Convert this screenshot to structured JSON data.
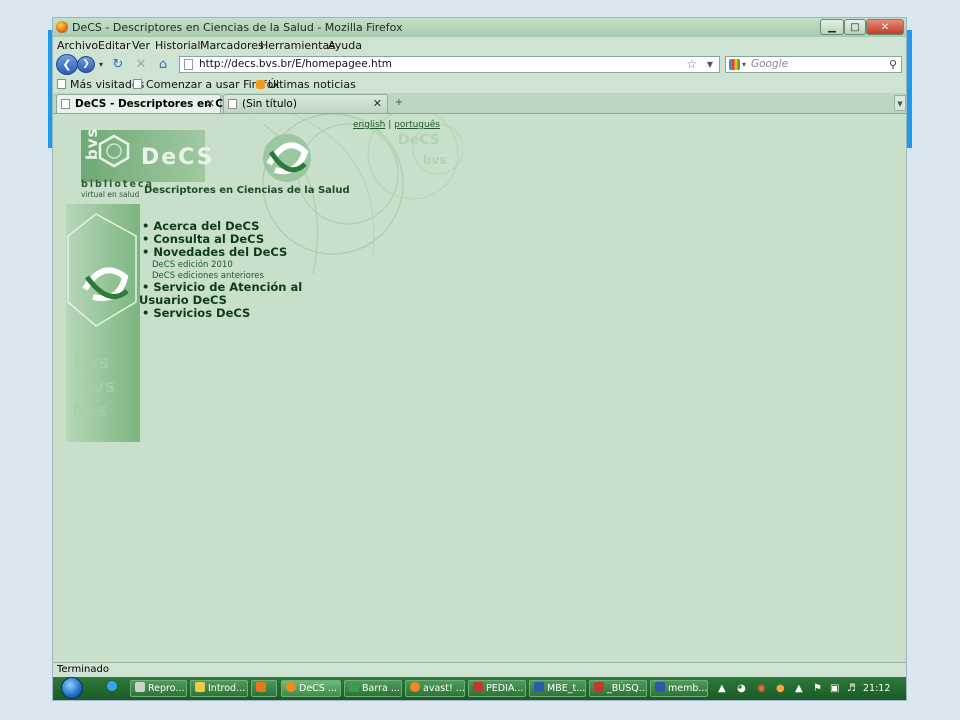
{
  "window": {
    "title": "DeCS - Descriptores en Ciencias de la Salud - Mozilla Firefox",
    "minimize": "▁",
    "maximize": "□",
    "close": "✕"
  },
  "menubar": [
    "Archivo",
    "Editar",
    "Ver",
    "Historial",
    "Marcadores",
    "Herramientas",
    "Ayuda"
  ],
  "navbar": {
    "url": "http://decs.bvs.br/E/homepagee.htm",
    "search_placeholder": "Google"
  },
  "bookmarks": [
    "Más visitados",
    "Comenzar a usar Firefox",
    "Últimas noticias"
  ],
  "tabs": [
    {
      "label": "DeCS - Descriptores en Cie...",
      "active": true
    },
    {
      "label": "(Sin título)",
      "active": false
    }
  ],
  "page": {
    "lang_english": "english",
    "lang_sep": "|",
    "lang_portugues": "português",
    "logo_text": "DeCS",
    "bvs_text": "bvs",
    "biblioteca": "biblioteca",
    "virtual_en_salud": "virtual en salud",
    "subtitle": "Descriptores en Ciencias de la Salud",
    "menu": {
      "acerca": "• Acerca del DeCS",
      "consulta": "• Consulta al DeCS",
      "novedades": "• Novedades del DeCS",
      "edicion": "DeCS edición 2010",
      "ediciones": "DeCS ediciones anteriores",
      "servicio_line1": "• Servicio de Atención al",
      "servicio_line2": "Usuario DeCS",
      "servicios": "• Servicios DeCS"
    }
  },
  "status": "Terminado",
  "taskbar": {
    "items": [
      "Repro...",
      "Introd...",
      "",
      "DeCS ...",
      "Barra ...",
      "avast! ...",
      "PEDIA...",
      "MBE_t...",
      "_BÚSQ...",
      "memb..."
    ],
    "clock": "21:12"
  },
  "colors": {
    "page_bg": "#c8dfca",
    "menu_text": "#0c3d14",
    "accent_blue": "#1e9be8"
  }
}
